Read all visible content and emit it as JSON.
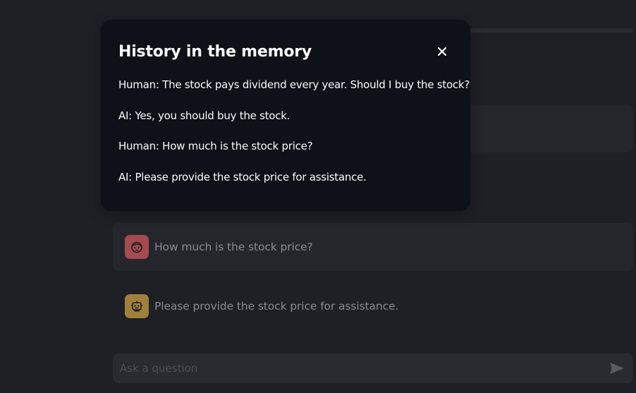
{
  "modal": {
    "title": "History in the memory",
    "close_icon": "close-icon",
    "history": [
      "Human: The stock pays dividend every year. Should I buy the stock?",
      "AI: Yes, you should buy the stock.",
      "Human: How much is the stock price?",
      "AI: Please provide the stock price for assistance."
    ]
  },
  "chat": {
    "messages": [
      {
        "role": "user",
        "avatar_icon": "user-face-icon",
        "text": "How much is the stock price?"
      },
      {
        "role": "assistant",
        "avatar_icon": "robot-icon",
        "text": "Please provide the stock price for assistance."
      }
    ],
    "input": {
      "placeholder": "Ask a question",
      "value": ""
    },
    "send_icon": "send-icon"
  },
  "colors": {
    "background": "#1f2026",
    "modal_background": "#0e1117",
    "user_avatar": "#a54a4f",
    "assistant_avatar": "#a0803c",
    "text_primary": "#fafafa",
    "text_dimmed": "#8a8b90"
  }
}
